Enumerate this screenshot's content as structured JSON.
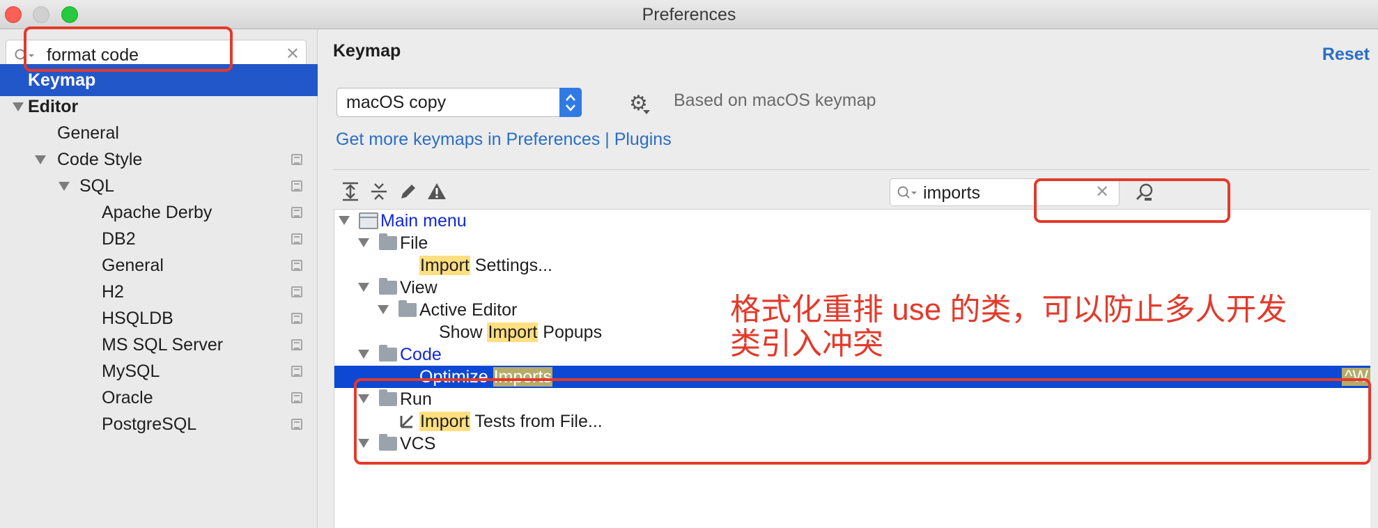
{
  "window": {
    "title": "Preferences"
  },
  "sidebar": {
    "search": {
      "value": "format code"
    },
    "items": [
      {
        "label": "Keymap"
      },
      {
        "label": "Editor"
      },
      {
        "label": "General"
      },
      {
        "label": "Code Style"
      },
      {
        "label": "SQL"
      },
      {
        "label": "Apache Derby"
      },
      {
        "label": "DB2"
      },
      {
        "label": "General"
      },
      {
        "label": "H2"
      },
      {
        "label": "HSQLDB"
      },
      {
        "label": "MS SQL Server"
      },
      {
        "label": "MySQL"
      },
      {
        "label": "Oracle"
      },
      {
        "label": "PostgreSQL"
      }
    ]
  },
  "main": {
    "title": "Keymap",
    "reset": "Reset",
    "keymap_select": "macOS copy",
    "based_on": "Based on macOS keymap",
    "plugins_link": "Get more keymaps in Preferences | Plugins",
    "search": {
      "value": "imports"
    },
    "tree": [
      {
        "label": "Main menu"
      },
      {
        "label": "File"
      },
      {
        "prefix": "",
        "match": "Import",
        "suffix": " Settings..."
      },
      {
        "label": "View"
      },
      {
        "label": "Active Editor"
      },
      {
        "prefix": "Show ",
        "match": "Import",
        "suffix": " Popups"
      },
      {
        "label": "Code"
      },
      {
        "prefix": "Optimize ",
        "match": "Imports",
        "suffix": "",
        "shortcut": "^W"
      },
      {
        "label": "Run"
      },
      {
        "prefix": "",
        "match": "Import",
        "suffix": " Tests from File..."
      },
      {
        "label": "VCS"
      }
    ]
  },
  "annotation": {
    "line1": "格式化重排 use 的类，可以防止多人开发",
    "line2": "类引入冲突"
  },
  "colors": {
    "accent": "#2257c9",
    "selection": "#0d48d4",
    "highlight": "#ffdf80",
    "annotation": "#e23a2b",
    "link": "#2a6ec4"
  }
}
